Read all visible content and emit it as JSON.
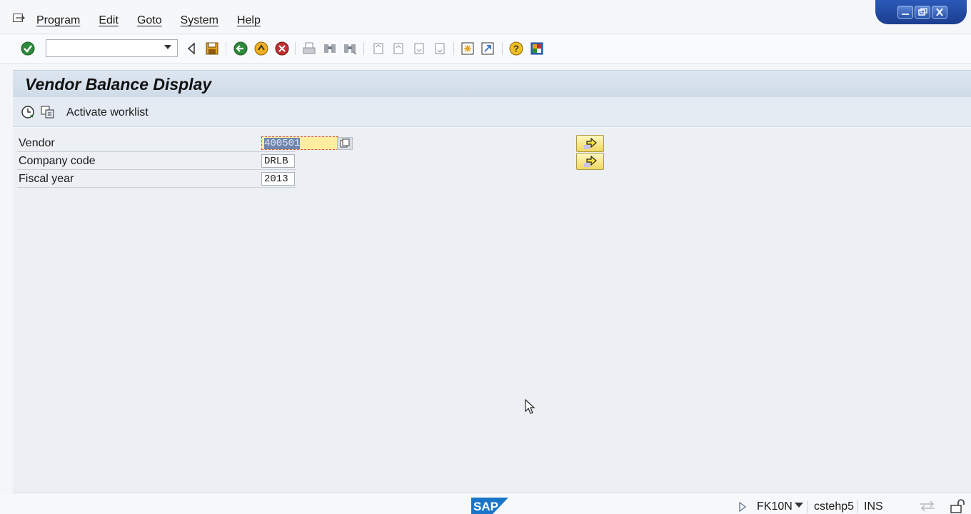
{
  "menubar": {
    "items": [
      "Program",
      "Edit",
      "Goto",
      "System",
      "Help"
    ]
  },
  "toolbar": {
    "command_field_value": "",
    "icons": [
      "enter-check-icon",
      "command-dropdown-icon",
      "collapse-icon",
      "save-icon",
      "back-icon",
      "exit-icon",
      "cancel-icon",
      "print-icon",
      "find-icon",
      "find-next-icon",
      "first-page-icon",
      "previous-page-icon",
      "next-page-icon",
      "last-page-icon",
      "create-session-icon",
      "shortcut-icon",
      "help-icon",
      "layout-icon"
    ]
  },
  "page": {
    "title": "Vendor Balance Display",
    "app_toolbar": {
      "activate_worklist_label": "Activate worklist"
    }
  },
  "form": {
    "rows": [
      {
        "label": "Vendor",
        "value": "400501"
      },
      {
        "label": "Company code",
        "value": "DRLB"
      },
      {
        "label": "Fiscal year",
        "value": "2013"
      }
    ]
  },
  "statusbar": {
    "logo": "SAP",
    "transaction": "FK10N",
    "server": "cstehp5",
    "mode": "INS"
  },
  "colors": {
    "title_bar": "#d6e0eb",
    "active_field": "#ffeea0",
    "nav_button": "#f2d860",
    "window_controls": "#2b59b8"
  }
}
